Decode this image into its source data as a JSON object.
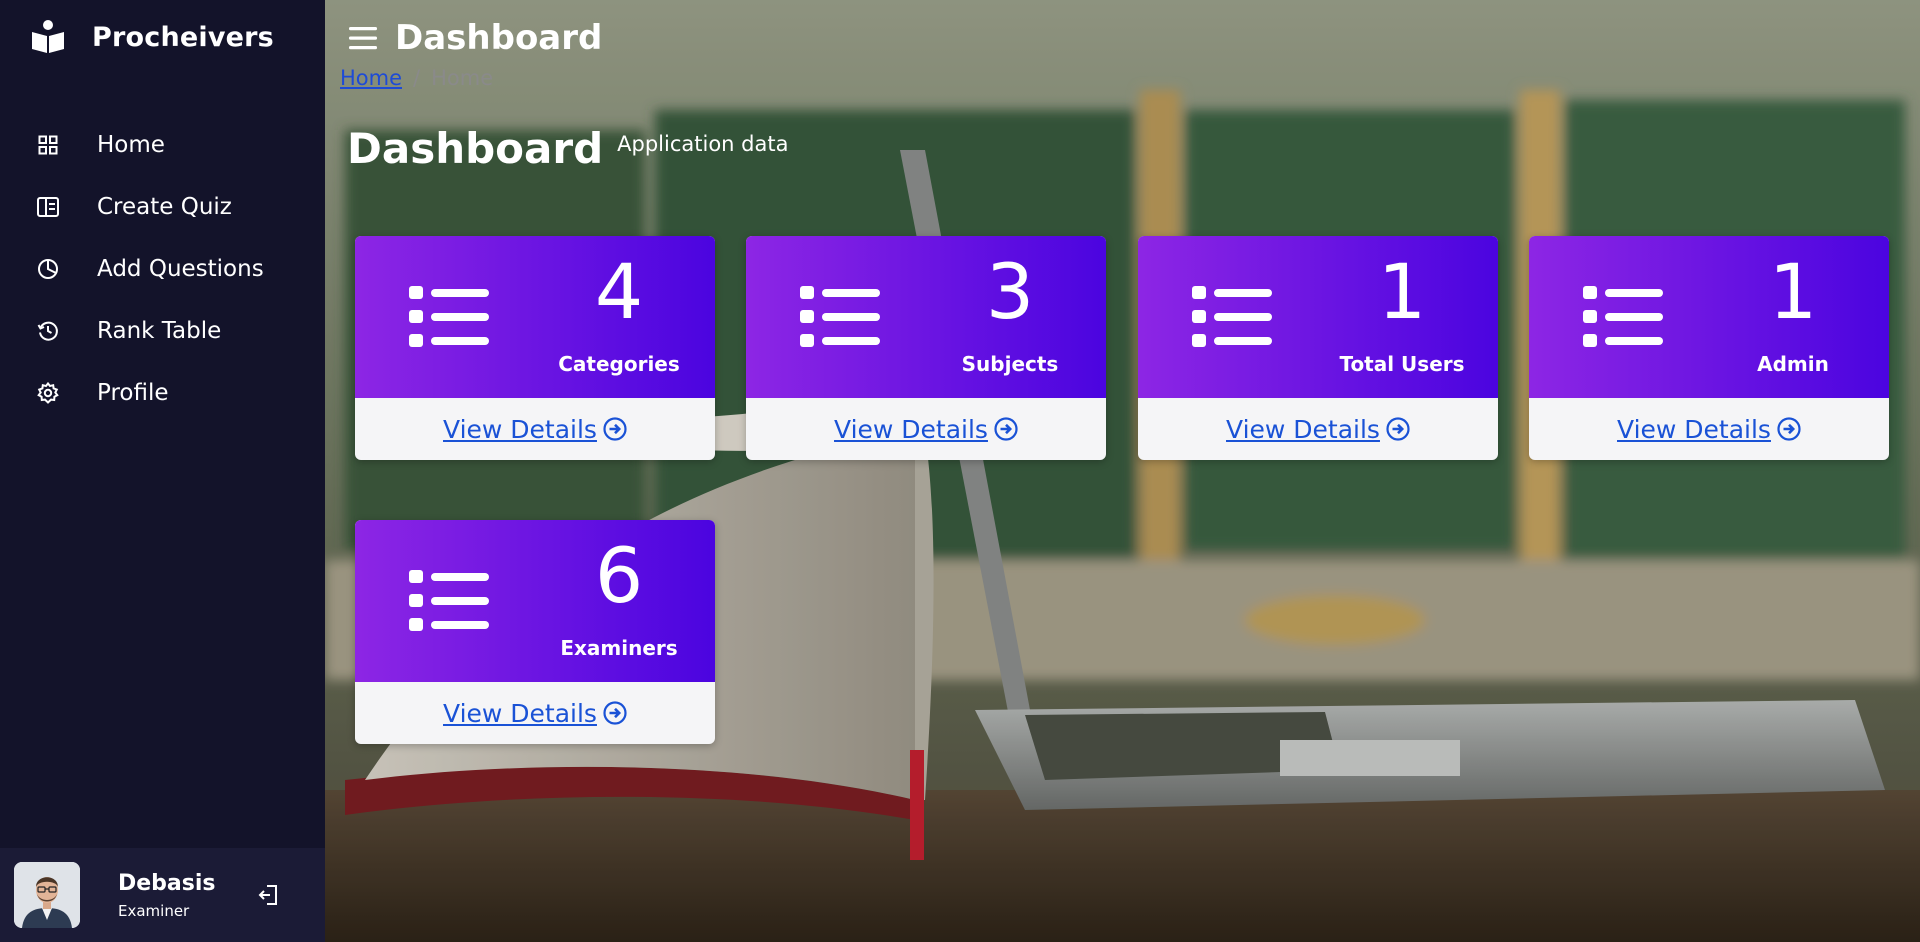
{
  "brand": {
    "name": "Procheivers"
  },
  "sidebar": {
    "items": [
      {
        "label": "Home",
        "icon": "grid-icon"
      },
      {
        "label": "Create Quiz",
        "icon": "layout-icon"
      },
      {
        "label": "Add Questions",
        "icon": "pie-chart-icon"
      },
      {
        "label": "Rank Table",
        "icon": "history-icon"
      },
      {
        "label": "Profile",
        "icon": "gear-icon"
      }
    ]
  },
  "user": {
    "name": "Debasis",
    "role": "Examiner"
  },
  "header": {
    "title": "Dashboard"
  },
  "breadcrumb": {
    "link": "Home",
    "separator": "/",
    "current": "Home"
  },
  "page": {
    "title": "Dashboard",
    "subtitle": "Application data"
  },
  "cards": [
    {
      "value": "4",
      "label": "Categories",
      "link": "View Details"
    },
    {
      "value": "3",
      "label": "Subjects",
      "link": "View Details"
    },
    {
      "value": "1",
      "label": "Total Users",
      "link": "View Details"
    },
    {
      "value": "1",
      "label": "Admin",
      "link": "View Details"
    },
    {
      "value": "6",
      "label": "Examiners",
      "link": "View Details"
    }
  ],
  "colors": {
    "sidebar": "#13132a",
    "card_gradient_start": "#8d26e4",
    "card_gradient_end": "#4b04e0",
    "link": "#1a52d6"
  }
}
